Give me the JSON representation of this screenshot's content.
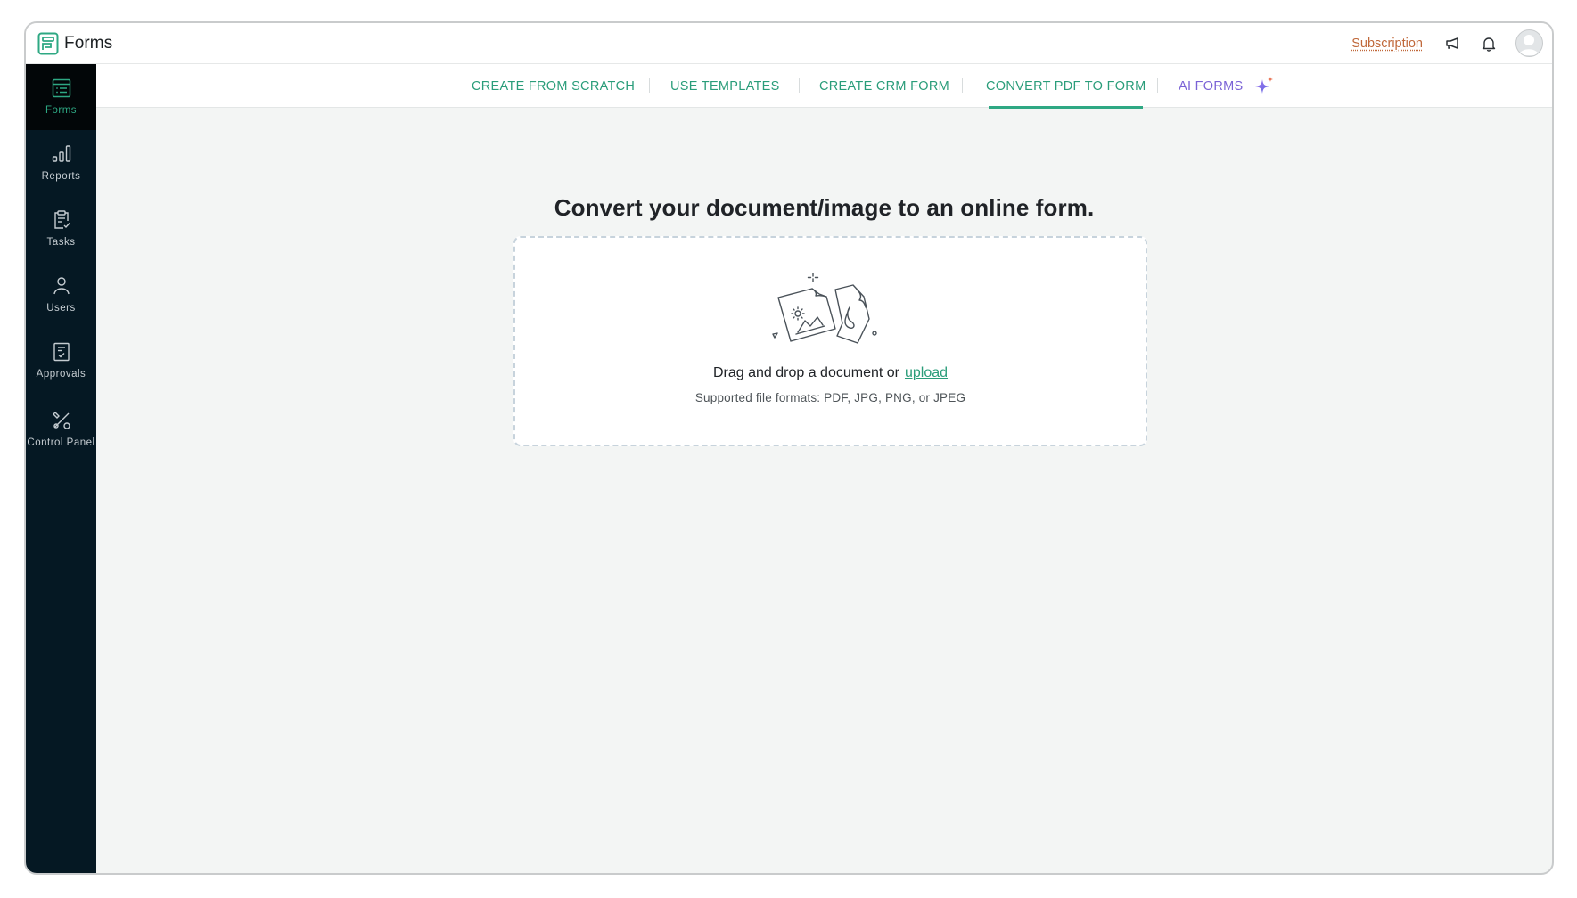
{
  "app": {
    "title": "Forms",
    "logo_icon": "forms-logo-icon",
    "brand_color": "#2ea883"
  },
  "header": {
    "subscription_label": "Subscription",
    "announcements_icon": "megaphone-icon",
    "notifications_icon": "bell-icon",
    "avatar_icon": "user-avatar-icon"
  },
  "sidebar": {
    "items": [
      {
        "label": "Forms",
        "icon": "forms-list-icon",
        "active": true
      },
      {
        "label": "Reports",
        "icon": "bar-chart-icon",
        "active": false
      },
      {
        "label": "Tasks",
        "icon": "clipboard-check-icon",
        "active": false
      },
      {
        "label": "Users",
        "icon": "user-icon",
        "active": false
      },
      {
        "label": "Approvals",
        "icon": "approval-document-icon",
        "active": false
      },
      {
        "label": "Control Panel",
        "icon": "tools-icon",
        "active": false
      }
    ]
  },
  "tabs": [
    {
      "label": "CREATE FROM SCRATCH",
      "active": false
    },
    {
      "label": "USE TEMPLATES",
      "active": false
    },
    {
      "label": "CREATE CRM FORM",
      "active": false
    },
    {
      "label": "CONVERT PDF TO FORM",
      "active": true
    },
    {
      "label": "AI FORMS",
      "active": false,
      "icon": "sparkle-icon"
    }
  ],
  "main": {
    "title": "Convert your document/image to an online form.",
    "dropzone": {
      "prompt": "Drag and drop a document or",
      "upload_label": "upload",
      "formats": "Supported file formats: PDF, JPG, PNG, or JPEG",
      "illustration_icon": "documents-upload-illustration"
    }
  },
  "colors": {
    "accent": "#2ea883",
    "ai_accent": "#7a62d6",
    "sidebar_bg": "#051823",
    "subscription": "#c0683a"
  }
}
